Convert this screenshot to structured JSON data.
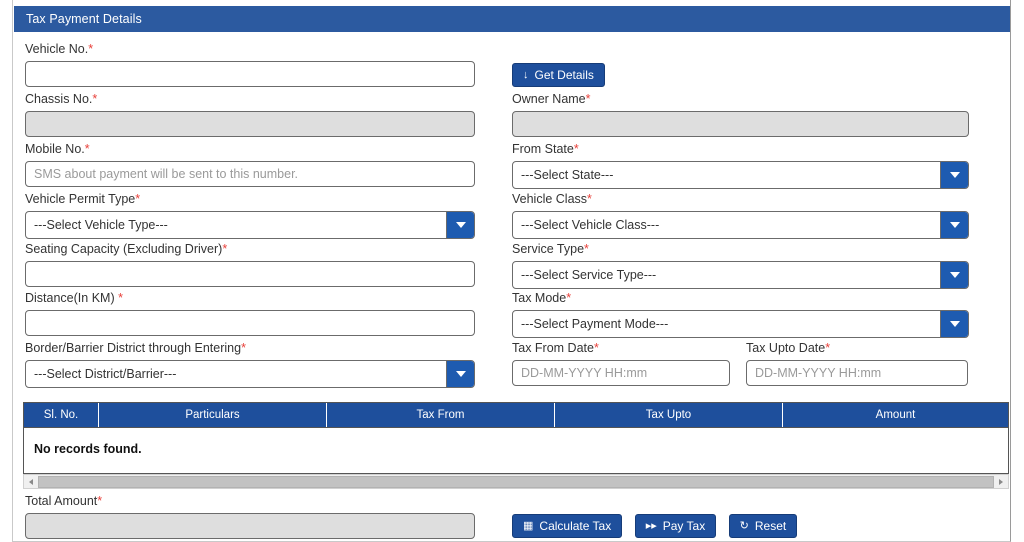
{
  "panel": {
    "title": "Tax Payment Details"
  },
  "required_mark": "*",
  "fields": {
    "vehicle_no": {
      "label": "Vehicle No.",
      "label_suffix": "*",
      "value": "",
      "placeholder": ""
    },
    "chassis_no": {
      "label": "Chassis No.",
      "label_suffix": "*",
      "value": "",
      "placeholder": "",
      "readonly": true
    },
    "owner_name": {
      "label": "Owner Name",
      "label_suffix": "*",
      "value": "",
      "placeholder": "",
      "readonly": true
    },
    "mobile_no": {
      "label": "Mobile No.",
      "label_suffix": "*",
      "value": "",
      "placeholder": "SMS about payment will be sent to this number."
    },
    "from_state": {
      "label": "From State",
      "label_suffix": "*",
      "selected": "---Select State---"
    },
    "vehicle_permit_type": {
      "label": "Vehicle Permit Type",
      "label_suffix": "*",
      "selected": "---Select Vehicle Type---"
    },
    "vehicle_class": {
      "label": "Vehicle Class",
      "label_suffix": "*",
      "selected": "---Select Vehicle Class---"
    },
    "seating_capacity": {
      "label": "Seating Capacity (Excluding Driver)",
      "label_suffix": "*",
      "value": "",
      "placeholder": ""
    },
    "service_type": {
      "label": "Service Type",
      "label_suffix": "*",
      "selected": "---Select Service Type---"
    },
    "distance_km": {
      "label": "Distance(In KM) ",
      "label_suffix": "*",
      "value": "",
      "placeholder": ""
    },
    "tax_mode": {
      "label": "Tax Mode",
      "label_suffix": "*",
      "selected": "---Select Payment Mode---"
    },
    "border_district": {
      "label": "Border/Barrier District through Entering",
      "label_suffix": "*",
      "selected": "---Select District/Barrier---"
    },
    "tax_from_date": {
      "label": "Tax From Date",
      "label_suffix": "*",
      "value": "",
      "placeholder": "DD-MM-YYYY HH:mm"
    },
    "tax_upto_date": {
      "label": "Tax Upto Date",
      "label_suffix": "*",
      "value": "",
      "placeholder": "DD-MM-YYYY HH:mm"
    },
    "total_amount": {
      "label": "Total Amount",
      "label_suffix": "*",
      "value": "",
      "placeholder": "",
      "readonly": true
    }
  },
  "buttons": {
    "get_details": {
      "label": "Get Details",
      "icon": "download-arrow-icon",
      "glyph": "↓"
    },
    "calculate_tax": {
      "label": "Calculate Tax",
      "icon": "calculator-grid-icon",
      "glyph": "▦"
    },
    "pay_tax": {
      "label": "Pay Tax",
      "icon": "fast-forward-icon",
      "glyph": "▸▸"
    },
    "reset": {
      "label": "Reset",
      "icon": "refresh-icon",
      "glyph": "↻"
    }
  },
  "table": {
    "columns": [
      "Sl. No.",
      "Particulars",
      "Tax From",
      "Tax Upto",
      "Amount"
    ],
    "rows": [],
    "empty_message": "No records found."
  },
  "colors": {
    "header_blue": "#2c5aa0",
    "table_header_blue": "#1e4f9c",
    "button_blue": "#1e4f9c",
    "dropdown_blue": "#1e5bb0",
    "required_red": "#e8403a",
    "readonly_gray": "#dedede"
  }
}
